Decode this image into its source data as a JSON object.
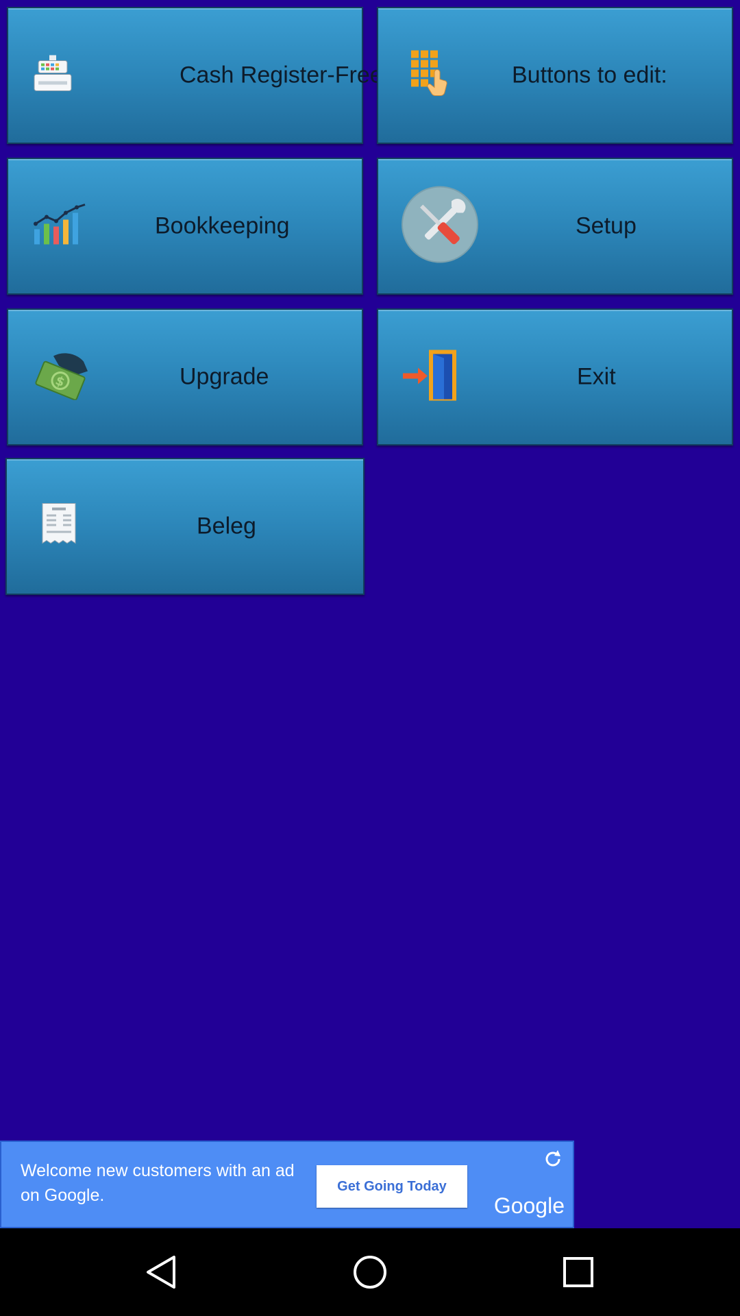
{
  "tiles": [
    {
      "label": "Cash Register-Free",
      "icon": "cash-register-icon"
    },
    {
      "label": "Buttons to edit:",
      "icon": "button-grid-icon"
    },
    {
      "label": "Bookkeeping",
      "icon": "bar-chart-icon"
    },
    {
      "label": "Setup",
      "icon": "wrench-screwdriver-icon"
    },
    {
      "label": "Upgrade",
      "icon": "money-hand-icon"
    },
    {
      "label": "Exit",
      "icon": "exit-door-icon"
    },
    {
      "label": "Beleg",
      "icon": "receipt-icon"
    }
  ],
  "ad": {
    "message": "Welcome new customers with an ad on Google.",
    "cta": "Get Going Today",
    "brand": "Google"
  },
  "colors": {
    "background": "#220096",
    "tile": "#2c86b9",
    "ad": "#4e8df5"
  }
}
